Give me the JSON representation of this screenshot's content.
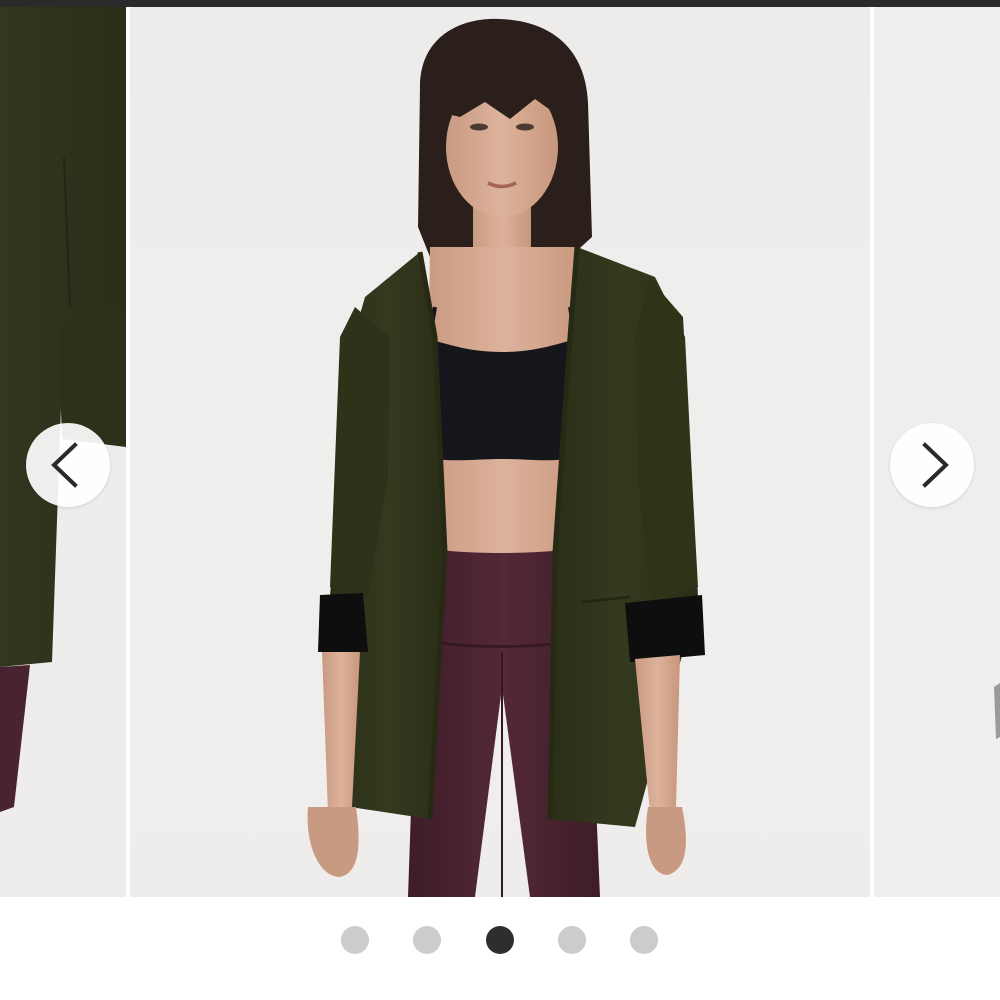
{
  "carousel": {
    "slides": [
      {
        "image": "product-photo-cardigan-side"
      },
      {
        "image": "product-photo-cardigan-front"
      },
      {
        "image": "product-photo-next"
      }
    ],
    "prev_icon": "chevron-left-icon",
    "next_icon": "chevron-right-icon",
    "colors": {
      "cardigan": "#2d3218",
      "leggings": "#4a2330",
      "background": "#efedeb"
    }
  },
  "pagination": {
    "count": 5,
    "active_index": 2,
    "active_color": "#2e2e2e",
    "inactive_color": "#cccccc"
  }
}
